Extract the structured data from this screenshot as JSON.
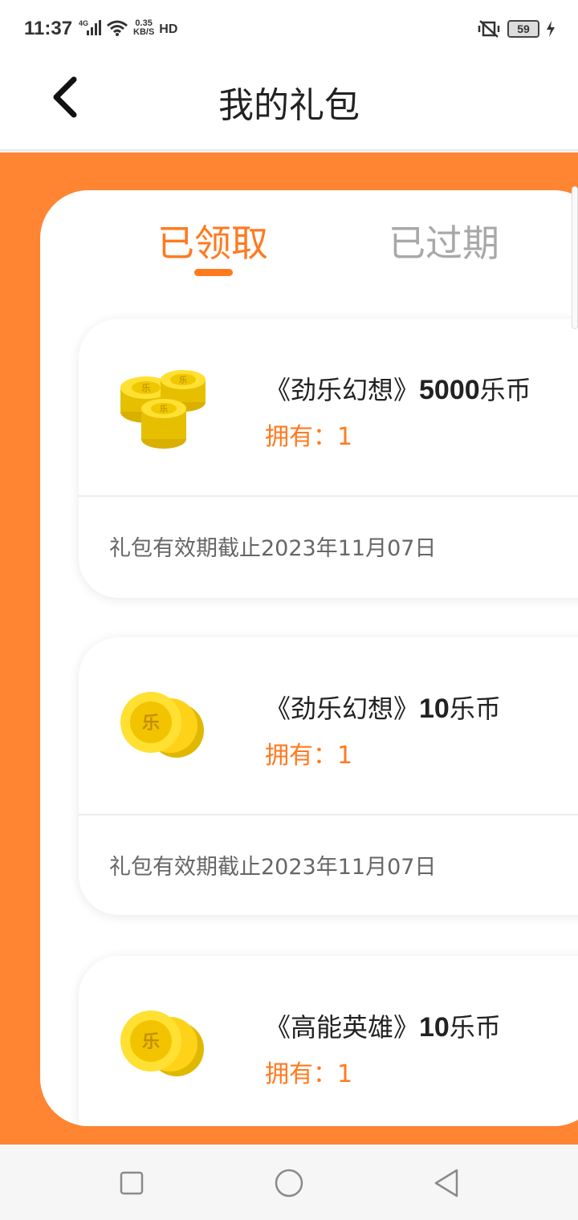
{
  "status_bar": {
    "time": "11:37",
    "network": "4G",
    "speed_value": "0.35",
    "speed_unit": "KB/S",
    "hd": "HD",
    "battery": "59"
  },
  "header": {
    "title": "我的礼包"
  },
  "tabs": [
    {
      "label": "已领取",
      "active": true
    },
    {
      "label": "已过期",
      "active": false
    }
  ],
  "gifts": [
    {
      "prefix": "《劲乐幻想》",
      "amount": "5000",
      "suffix": "乐币",
      "qty": "拥有：1",
      "expire": "礼包有效期截止2023年11月07日",
      "icon": "coin-stack-icon"
    },
    {
      "prefix": "《劲乐幻想》",
      "amount": "10",
      "suffix": "乐币",
      "qty": "拥有：1",
      "expire": "礼包有效期截止2023年11月07日",
      "icon": "coin-pile-icon"
    },
    {
      "prefix": "《高能英雄》",
      "amount": "10",
      "suffix": "乐币",
      "qty": "拥有：1",
      "expire": "",
      "icon": "coin-pile-icon"
    }
  ],
  "colors": {
    "accent": "#ff7a1f",
    "orange_bg": "#ff8533",
    "inactive_tab": "#a8a8a8"
  },
  "nav": [
    "square-icon",
    "circle-icon",
    "triangle-back-icon"
  ]
}
